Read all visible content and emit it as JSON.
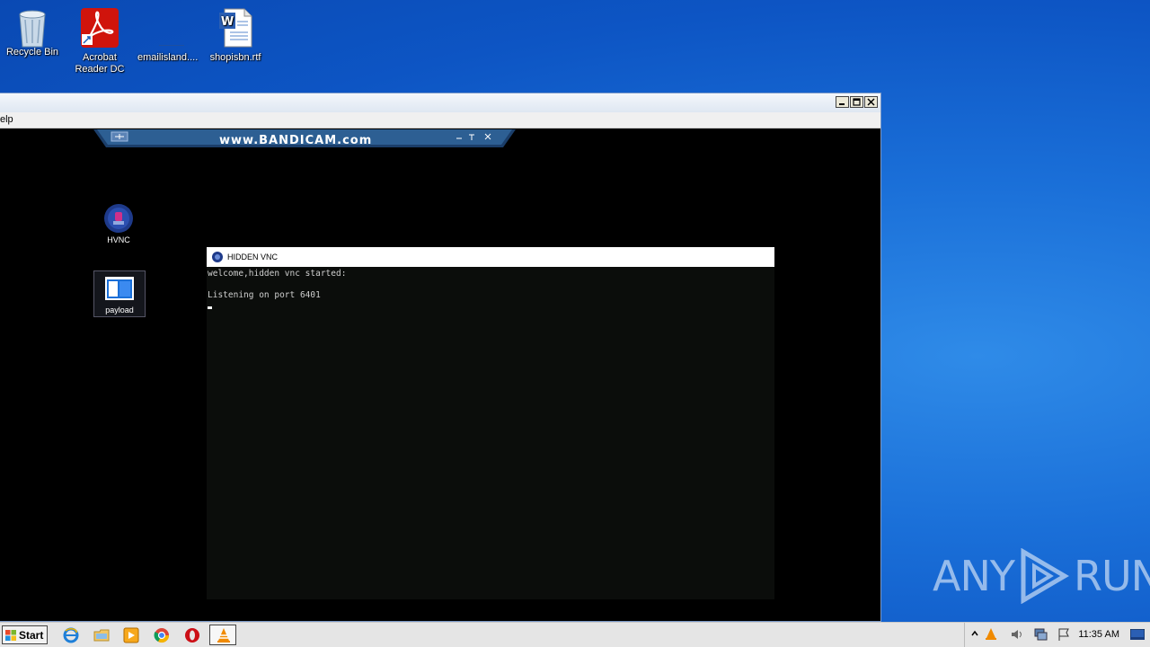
{
  "desktop": {
    "icons": [
      {
        "label": "Recycle Bin"
      },
      {
        "label": "Acrobat Reader DC"
      },
      {
        "label": "emailisland...."
      },
      {
        "label": "shopisbn.rtf"
      }
    ]
  },
  "window": {
    "menu_fragment": "elp"
  },
  "bandicam": {
    "banner_text": "www.BANDICAM.com"
  },
  "remote_desktop": {
    "icons": [
      {
        "label": "HVNC"
      },
      {
        "label": "payload"
      }
    ],
    "console": {
      "title": "HIDDEN VNC",
      "lines": [
        "welcome,hidden vnc started:",
        "",
        "Listening on port 6401"
      ]
    }
  },
  "taskbar": {
    "start_label": "Start",
    "clock": "11:35 AM"
  },
  "watermark": {
    "text_left": "ANY",
    "text_right": "RUN"
  },
  "colors": {
    "desktop_bg": "#0d55c4",
    "acrobat_red": "#d0140c",
    "vlc_orange": "#f08a00"
  }
}
